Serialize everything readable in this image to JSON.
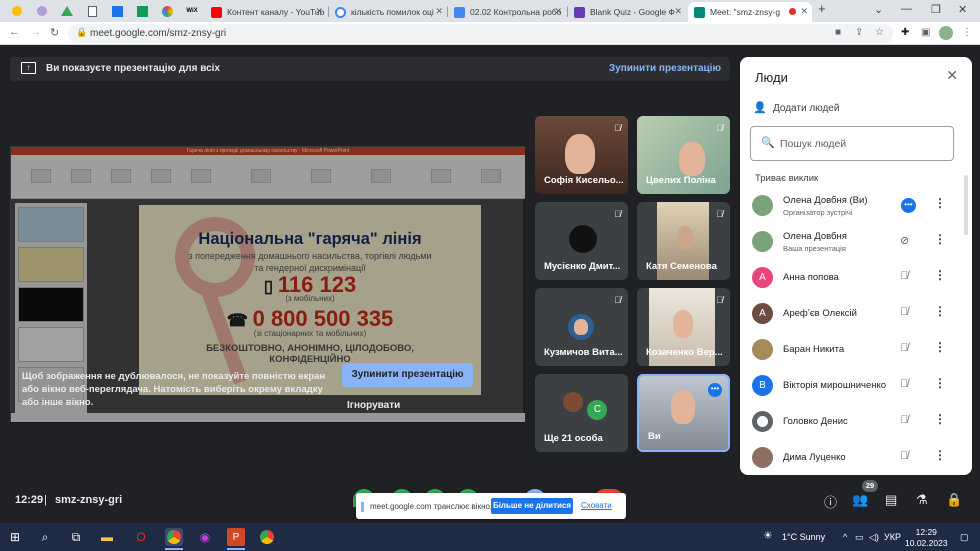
{
  "browser": {
    "tabs": [
      {
        "title": "Контент каналу - YouTub",
        "fav_color": "#ff0000"
      },
      {
        "title": "кількість помилок оці",
        "fav_color": "#4285f4"
      },
      {
        "title": "02.02 Контрольна робо",
        "fav_color": "#4285f4"
      },
      {
        "title": "Blank Quiz - Google Ф",
        "fav_color": "#673ab7"
      },
      {
        "title": "Meet: \"smz-znsy-g",
        "fav_color": "#00897b"
      }
    ],
    "pinned_icons": [
      "pin-icon-1",
      "pin-icon-2",
      "drive-icon",
      "docs-icon",
      "grid-app-icon",
      "classroom-icon",
      "palette-icon",
      "wix-icon"
    ],
    "pinned_labels": {
      "wix": "WiX"
    },
    "url": "meet.google.com/smz-znsy-gri",
    "new_tab_symbol": "+"
  },
  "banner": {
    "text": "Ви показуєте презентацію для всіх",
    "stop_label": "Зупинити презентацію"
  },
  "slide": {
    "window_title": "Гаряча лінія з протидії домашньому насильству - Microsoft PowerPoint",
    "title": "Національна \"гаряча\" лінія",
    "subtitle": "з попередження домашнього насильства, торгівлі людьми та гендерної дискримінації",
    "phone1": "116 123",
    "phone1_caption": "(з мобільних)",
    "phone2": "0 800 500 335",
    "phone2_caption": "(зі стаціонарних та мобільних)",
    "footer": "БЕЗКОШТОВНО, АНОНІМНО, ЦІЛОДОБОВО, КОНФІДЕНЦІЙНО"
  },
  "share_warning": {
    "text": "Щоб зображення не дублювалося, не показуйте повністю екран або вікно веб-переглядача. Натомість виберіть окрему вкладку або інше вікно.",
    "present_tab_label": "Зупинити презентацію",
    "ignore_label": "Ігнорувати"
  },
  "tiles": [
    {
      "name": "Софія Кисельо...",
      "bg": "#5b3a2e"
    },
    {
      "name": "Цвелих Поліна",
      "bg": "#9fb7a0"
    },
    {
      "name": "Мусієнко Дмит...",
      "bg": "#3c4043"
    },
    {
      "name": "Катя Семенова",
      "bg": "#c9b79a"
    },
    {
      "name": "Кузмичов Вита...",
      "bg": "#3c4043"
    },
    {
      "name": "Козаченко Вер...",
      "bg": "#d8d2c6"
    },
    {
      "name": "Ще 21 особа",
      "bg": "#3c4043"
    },
    {
      "name": "Ви",
      "bg": "#9aa3ad"
    }
  ],
  "more_avatar_letter": "С",
  "people_panel": {
    "title": "Люди",
    "add_label": "Додати людей",
    "search_placeholder": "Пошук людей",
    "section": "Триває виклик",
    "people": [
      {
        "name": "Олена Довбня (Ви)",
        "sub": "Організатор зустрічі",
        "initial": "",
        "color": "#7aa37a"
      },
      {
        "name": "Олена Довбня",
        "sub": "Ваша презентація",
        "initial": "",
        "color": "#7aa37a"
      },
      {
        "name": "Анна попова",
        "sub": "",
        "initial": "А",
        "color": "#e8457a"
      },
      {
        "name": "Арефʼєв Олексій",
        "sub": "",
        "initial": "А",
        "color": "#6d4c41"
      },
      {
        "name": "Баран Никита",
        "sub": "",
        "initial": "",
        "color": "#a58a5a"
      },
      {
        "name": "Вікторія мирошниченко",
        "sub": "",
        "initial": "В",
        "color": "#1a73e8"
      },
      {
        "name": "Головко Денис",
        "sub": "",
        "initial": "",
        "color": "#5f6368"
      },
      {
        "name": "Дима Луценко",
        "sub": "",
        "initial": "",
        "color": "#8d6e63"
      }
    ]
  },
  "bottom_bar": {
    "time": "12:29",
    "separator": "|",
    "meeting_code": "smz-znsy-gri",
    "people_count": "29",
    "share_notice": "meet.google.com транслює вікно.",
    "stop_share_label": "Більше не ділитися",
    "hide_label": "Сховати"
  },
  "taskbar": {
    "weather": "1°C  Sunny",
    "lang": "УКР",
    "time": "12:29",
    "date": "10.02.2023"
  }
}
